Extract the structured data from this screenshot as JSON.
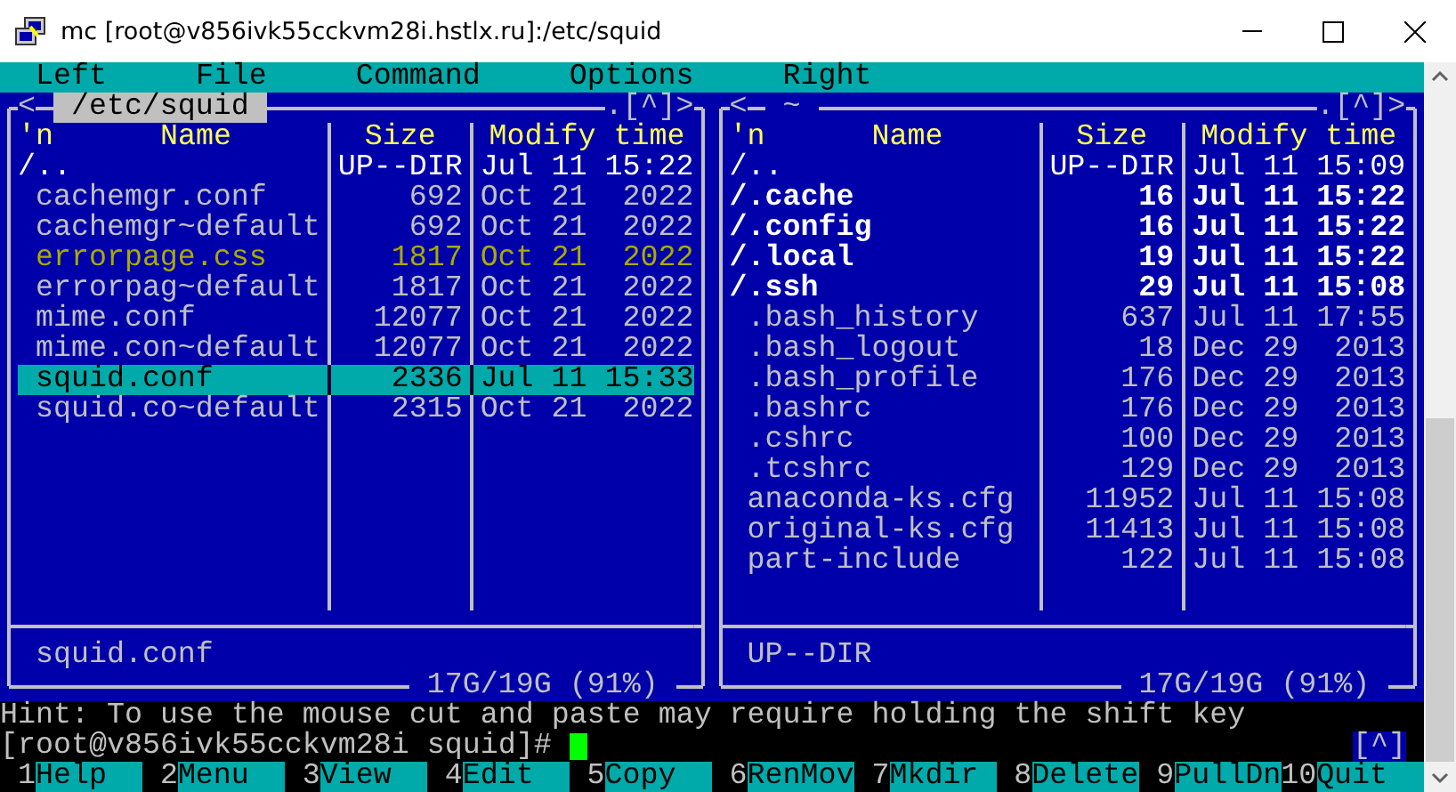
{
  "window": {
    "title": "mc [root@v856ivk55cckvm28i.hstlx.ru]:/etc/squid"
  },
  "menu": [
    "Left",
    "File",
    "Command",
    "Options",
    "Right"
  ],
  "panels": [
    {
      "back": "<",
      "path": "/etc/squid",
      "active": true,
      "corner": ".[^]>",
      "columns": [
        "'n",
        "Name",
        "Size",
        "Modify time"
      ],
      "files": [
        {
          "name": "/..",
          "size": "UP--DIR",
          "time": "Jul 11 15:22",
          "kind": "updir",
          "selected": false
        },
        {
          "name": "cachemgr.conf",
          "size": "692",
          "time": "Oct 21  2022",
          "kind": "file",
          "selected": false
        },
        {
          "name": "cachemgr~default",
          "size": "692",
          "time": "Oct 21  2022",
          "kind": "file",
          "selected": false
        },
        {
          "name": "errorpage.css",
          "size": "1817",
          "time": "Oct 21  2022",
          "kind": "css",
          "selected": false
        },
        {
          "name": "errorpag~default",
          "size": "1817",
          "time": "Oct 21  2022",
          "kind": "file",
          "selected": false
        },
        {
          "name": "mime.conf",
          "size": "12077",
          "time": "Oct 21  2022",
          "kind": "file",
          "selected": false
        },
        {
          "name": "mime.con~default",
          "size": "12077",
          "time": "Oct 21  2022",
          "kind": "file",
          "selected": false
        },
        {
          "name": "squid.conf",
          "size": "2336",
          "time": "Jul 11 15:33",
          "kind": "file",
          "selected": true
        },
        {
          "name": "squid.co~default",
          "size": "2315",
          "time": "Oct 21  2022",
          "kind": "file",
          "selected": false
        }
      ],
      "mini_status": "squid.conf",
      "free_space": "17G/19G (91%)"
    },
    {
      "back": "<",
      "path": "~",
      "active": false,
      "corner": ".[^]>",
      "columns": [
        "'n",
        "Name",
        "Size",
        "Modify time"
      ],
      "files": [
        {
          "name": "/..",
          "size": "UP--DIR",
          "time": "Jul 11 15:09",
          "kind": "updir",
          "selected": false
        },
        {
          "name": "/.cache",
          "size": "16",
          "time": "Jul 11 15:22",
          "kind": "dir",
          "selected": false
        },
        {
          "name": "/.config",
          "size": "16",
          "time": "Jul 11 15:22",
          "kind": "dir",
          "selected": false
        },
        {
          "name": "/.local",
          "size": "19",
          "time": "Jul 11 15:22",
          "kind": "dir",
          "selected": false
        },
        {
          "name": "/.ssh",
          "size": "29",
          "time": "Jul 11 15:08",
          "kind": "dir",
          "selected": false
        },
        {
          "name": ".bash_history",
          "size": "637",
          "time": "Jul 11 17:55",
          "kind": "file",
          "selected": false
        },
        {
          "name": ".bash_logout",
          "size": "18",
          "time": "Dec 29  2013",
          "kind": "file",
          "selected": false
        },
        {
          "name": ".bash_profile",
          "size": "176",
          "time": "Dec 29  2013",
          "kind": "file",
          "selected": false
        },
        {
          "name": ".bashrc",
          "size": "176",
          "time": "Dec 29  2013",
          "kind": "file",
          "selected": false
        },
        {
          "name": ".cshrc",
          "size": "100",
          "time": "Dec 29  2013",
          "kind": "file",
          "selected": false
        },
        {
          "name": ".tcshrc",
          "size": "129",
          "time": "Dec 29  2013",
          "kind": "file",
          "selected": false
        },
        {
          "name": "anaconda-ks.cfg",
          "size": "11952",
          "time": "Jul 11 15:08",
          "kind": "file",
          "selected": false
        },
        {
          "name": "original-ks.cfg",
          "size": "11413",
          "time": "Jul 11 15:08",
          "kind": "file",
          "selected": false
        },
        {
          "name": "part-include",
          "size": "122",
          "time": "Jul 11 15:08",
          "kind": "file",
          "selected": false
        }
      ],
      "mini_status": "UP--DIR",
      "free_space": "17G/19G (91%)"
    }
  ],
  "hint": "Hint: To use the mouse cut and paste may require holding the shift key",
  "prompt": {
    "text": "[root@v856ivk55cckvm28i squid]#",
    "corner": "[^]"
  },
  "function_keys": [
    {
      "number": "1",
      "label": "Help"
    },
    {
      "number": "2",
      "label": "Menu"
    },
    {
      "number": "3",
      "label": "View"
    },
    {
      "number": "4",
      "label": "Edit"
    },
    {
      "number": "5",
      "label": "Copy"
    },
    {
      "number": "6",
      "label": "RenMov"
    },
    {
      "number": "7",
      "label": "Mkdir"
    },
    {
      "number": "8",
      "label": "Delete"
    },
    {
      "number": "9",
      "label": "PullDn"
    },
    {
      "number": "10",
      "label": "Quit"
    }
  ]
}
